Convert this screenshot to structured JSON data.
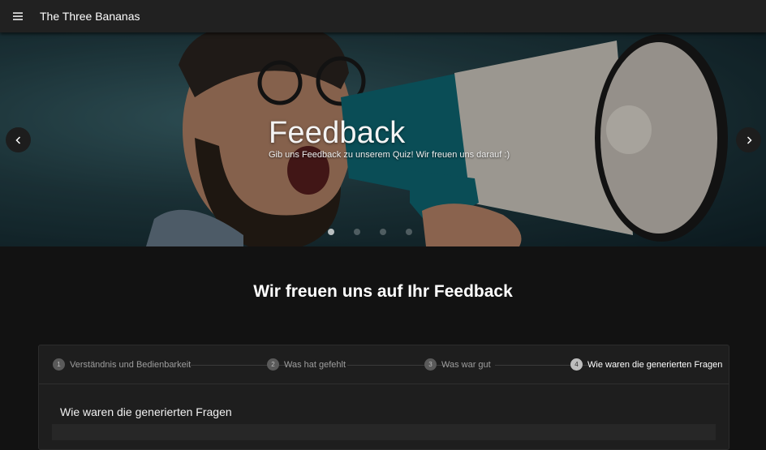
{
  "appbar": {
    "title": "The Three Bananas",
    "menu_icon": "menu-icon"
  },
  "hero": {
    "title": "Feedback",
    "subtitle": "Gib uns Feedback zu unserem Quiz! Wir freuen uns darauf :)",
    "prev_icon": "chevron-left-icon",
    "next_icon": "chevron-right-icon",
    "slides": 4,
    "active_slide": 0
  },
  "main": {
    "heading": "Wir freuen uns auf Ihr Feedback"
  },
  "stepper": {
    "steps": [
      {
        "number": "1",
        "label": "Verständnis und Bedienbarkeit"
      },
      {
        "number": "2",
        "label": "Was hat gefehlt"
      },
      {
        "number": "3",
        "label": "Was war gut"
      },
      {
        "number": "4",
        "label": "Wie waren die generierten Fragen"
      }
    ],
    "active_step": 3,
    "content_title": "Wie waren die generierten Fragen"
  },
  "colors": {
    "appbar_bg": "#212121",
    "page_bg": "#121212",
    "card_bg": "#1e1e1e"
  }
}
